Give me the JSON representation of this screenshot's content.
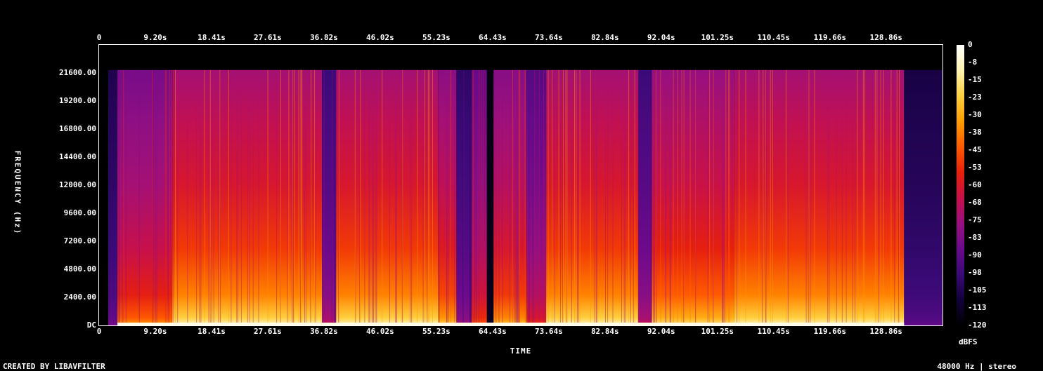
{
  "chart_data": {
    "type": "heatmap",
    "title": "",
    "xlabel": "TIME",
    "ylabel": "FREQUENCY (Hz)",
    "x_ticks": [
      "0",
      "9.20s",
      "18.41s",
      "27.61s",
      "36.82s",
      "46.02s",
      "55.23s",
      "64.43s",
      "73.64s",
      "82.84s",
      "92.04s",
      "101.25s",
      "110.45s",
      "119.66s",
      "128.86s"
    ],
    "x_tick_values": [
      0,
      9.2,
      18.41,
      27.61,
      36.82,
      46.02,
      55.23,
      64.43,
      73.64,
      82.84,
      92.04,
      101.25,
      110.45,
      119.66,
      128.86
    ],
    "xlim": [
      0,
      138.1
    ],
    "y_ticks": [
      "DC",
      "2400.00",
      "4800.00",
      "7200.00",
      "9600.00",
      "12000.00",
      "14400.00",
      "16800.00",
      "19200.00",
      "21600.00"
    ],
    "y_tick_values": [
      0,
      2400,
      4800,
      7200,
      9600,
      12000,
      14400,
      16800,
      19200,
      21600
    ],
    "ylim": [
      0,
      24000
    ],
    "colorbar": {
      "label": "dBFS",
      "ticks": [
        "0",
        "-8",
        "-15",
        "-23",
        "-30",
        "-38",
        "-45",
        "-53",
        "-60",
        "-68",
        "-75",
        "-83",
        "-90",
        "-98",
        "-105",
        "-113",
        "-120"
      ],
      "range": [
        -120,
        0
      ],
      "colormap": [
        "#000000",
        "#12003a",
        "#3a0a78",
        "#6a0a8c",
        "#9a1080",
        "#c8104a",
        "#e8200a",
        "#ff5a00",
        "#ff9e00",
        "#ffd040",
        "#fff4b0",
        "#ffffff"
      ]
    },
    "segments": [
      {
        "start": 1.5,
        "end": 3.0,
        "level": 0.25
      },
      {
        "start": 3.0,
        "end": 12.0,
        "level": 0.62
      },
      {
        "start": 12.0,
        "end": 36.5,
        "level": 0.8
      },
      {
        "start": 36.5,
        "end": 38.8,
        "level": 0.38
      },
      {
        "start": 38.8,
        "end": 55.5,
        "level": 0.8
      },
      {
        "start": 55.5,
        "end": 58.5,
        "level": 0.7
      },
      {
        "start": 58.5,
        "end": 61.0,
        "level": 0.32
      },
      {
        "start": 61.0,
        "end": 63.5,
        "level": 0.55
      },
      {
        "start": 63.5,
        "end": 64.6,
        "level": 0.05
      },
      {
        "start": 64.6,
        "end": 70.0,
        "level": 0.68
      },
      {
        "start": 70.0,
        "end": 73.2,
        "level": 0.48
      },
      {
        "start": 73.2,
        "end": 88.3,
        "level": 0.8
      },
      {
        "start": 88.3,
        "end": 90.5,
        "level": 0.38
      },
      {
        "start": 90.5,
        "end": 104.0,
        "level": 0.74
      },
      {
        "start": 104.0,
        "end": 131.8,
        "level": 0.8
      },
      {
        "start": 131.8,
        "end": 138.1,
        "level": 0.22
      }
    ],
    "bandwidth_hz": 21850
  },
  "footer": {
    "credit": "CREATED BY LIBAVFILTER",
    "sample_info": "48000 Hz | stereo"
  }
}
